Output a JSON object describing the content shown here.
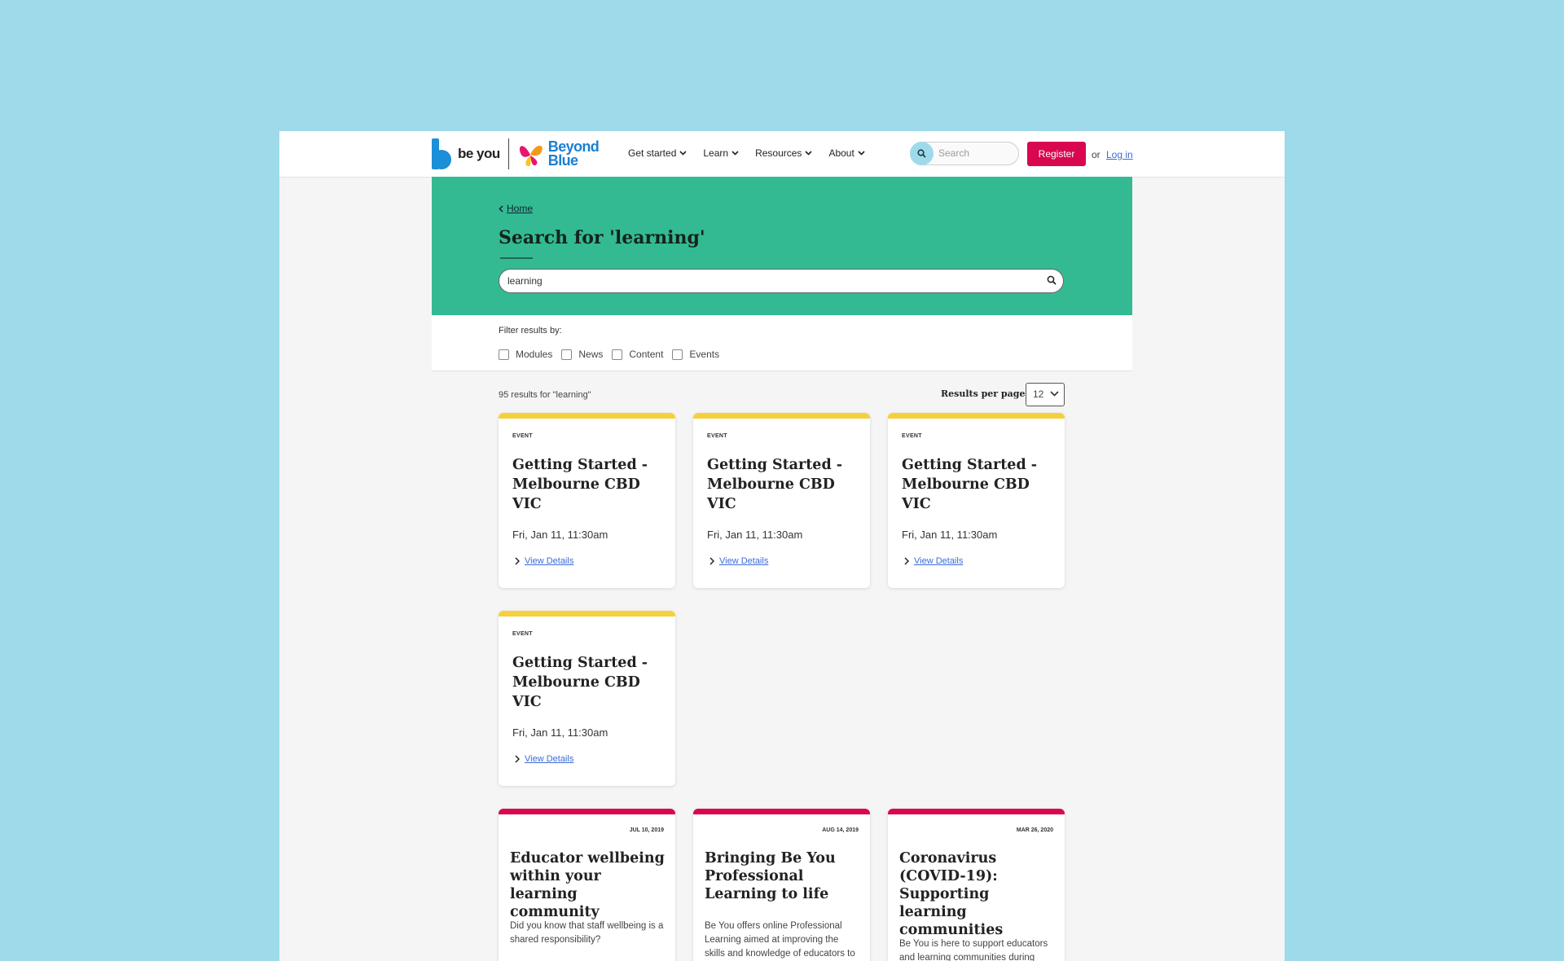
{
  "header": {
    "logo_beyou": "be you",
    "logo_beyond_blue": "Beyond Blue",
    "nav": [
      {
        "label": "Get started"
      },
      {
        "label": "Learn"
      },
      {
        "label": "Resources"
      },
      {
        "label": "About"
      }
    ],
    "search_placeholder": "Search",
    "register_label": "Register",
    "or_text": "or",
    "login_label": "Log in"
  },
  "hero": {
    "breadcrumb": "Home",
    "title": "Search for 'learning'",
    "search_value": "learning"
  },
  "filters": {
    "label": "Filter results by:",
    "options": [
      "Modules",
      "News",
      "Content",
      "Events"
    ]
  },
  "results": {
    "count_text": "95 results for \"learning\"",
    "per_page_label": "Results per page",
    "per_page_value": "12"
  },
  "event_cards": [
    {
      "kind": "EVENT",
      "title": "Getting Started - Melbourne CBD VIC",
      "date": "Fri, Jan 11, 11:30am",
      "link": "View Details"
    },
    {
      "kind": "EVENT",
      "title": "Getting Started - Melbourne CBD VIC",
      "date": "Fri, Jan 11, 11:30am",
      "link": "View Details"
    },
    {
      "kind": "EVENT",
      "title": "Getting Started - Melbourne CBD VIC",
      "date": "Fri, Jan 11, 11:30am",
      "link": "View Details"
    },
    {
      "kind": "EVENT",
      "title": "Getting Started - Melbourne CBD VIC",
      "date": "Fri, Jan 11, 11:30am",
      "link": "View Details"
    }
  ],
  "article_cards": [
    {
      "date": "JUL 10, 2019",
      "title": "Educator wellbeing within your learning community",
      "desc": "Did you know that staff wellbeing is a shared responsibility?"
    },
    {
      "date": "AUG 14, 2019",
      "title": "Bringing Be You Professional Learning to life",
      "desc": "Be You offers online Professional Learning aimed at improving the skills and knowledge of educators to"
    },
    {
      "date": "MAR 26, 2020",
      "title": "Coronavirus (COVID-19): Supporting learning communities",
      "desc": "Be You is here to support educators and learning communities during"
    }
  ],
  "colors": {
    "page_bg": "#9fdaea",
    "hero_bg": "#33ba93",
    "event_accent": "#f6d03c",
    "article_accent": "#d9074f",
    "register_bg": "#d9074f",
    "link": "#3b6bd6"
  }
}
